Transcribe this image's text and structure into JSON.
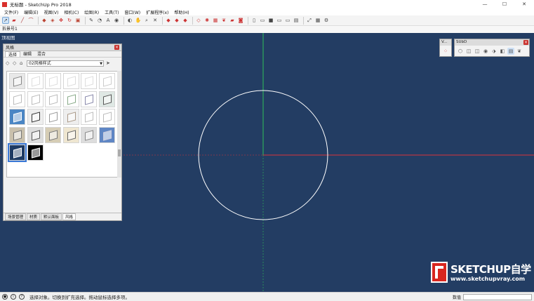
{
  "window": {
    "title": "无标题 - SketchUp Pro 2018",
    "minimize": "—",
    "maximize": "☐",
    "close": "✕"
  },
  "menu": [
    "文件(F)",
    "编辑(E)",
    "视图(V)",
    "相机(C)",
    "绘图(R)",
    "工具(T)",
    "窗口(W)",
    "扩展程序(x)",
    "帮助(H)"
  ],
  "measure_bar": {
    "label": "拆景号1"
  },
  "viewport": {
    "scene_label": "顶视图",
    "background": "#233d63",
    "axis_green": "#2fbf5a",
    "axis_red": "#d9333b"
  },
  "styles_tray": {
    "title": "风格",
    "tabs": [
      "选择",
      "编辑",
      "混合"
    ],
    "selected_style": "02风格样式",
    "bottom_tabs": [
      "场景管理",
      "材质",
      "默认面板",
      "风格"
    ]
  },
  "panel_v": {
    "title": "V..."
  },
  "panel_sub": {
    "title": "SUbD"
  },
  "watermark": {
    "title": "SKETCHUP自学",
    "url": "www.sketchupvray.com"
  },
  "status": {
    "message": "选择对象。切换到扩充选择。拖动鼠标选择多项。",
    "measure_label": "数值"
  }
}
